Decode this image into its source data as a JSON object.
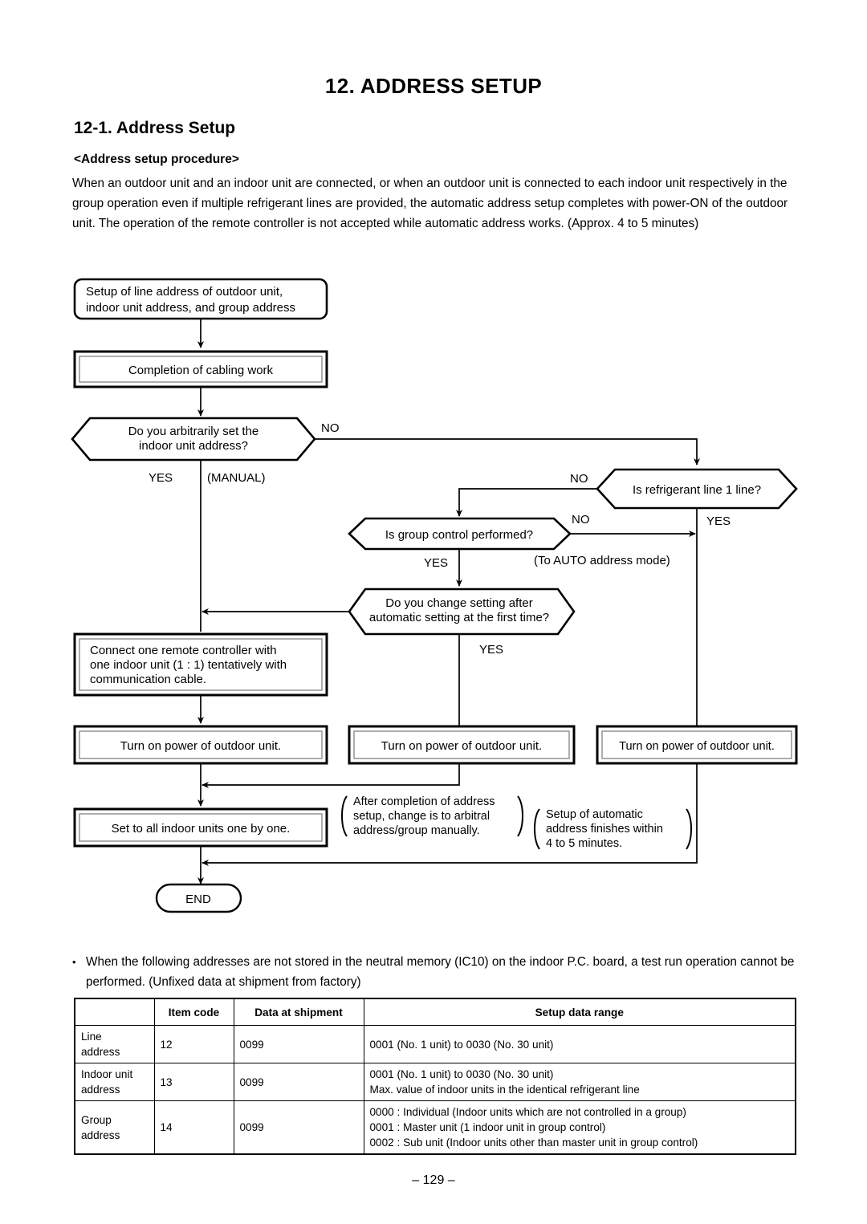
{
  "document": {
    "chapter_title": "12.  ADDRESS SETUP",
    "section_title": "12-1.  Address Setup",
    "sub_title": "<Address setup procedure>",
    "intro_paragraph": "When an outdoor unit and an indoor unit are connected, or when an outdoor unit is connected to each indoor unit respectively in the group operation even if multiple refrigerant lines are provided, the automatic address setup completes with power-ON of the outdoor unit. The operation of the remote controller is not accepted while automatic address works. (Approx. 4 to 5 minutes)",
    "page_number": "–  129  –"
  },
  "flowchart": {
    "start_box": {
      "line1": "Setup of line address of outdoor unit,",
      "line2": "indoor unit address, and group address"
    },
    "cabling_box": "Completion of cabling work",
    "decision_arbitrary": {
      "line1": "Do you arbitrarily set the",
      "line2": "indoor unit address?",
      "yes": "YES",
      "no": "NO",
      "manual": "(MANUAL)"
    },
    "decision_refrigerant": {
      "text": "Is refrigerant line 1 line?",
      "yes": "YES",
      "no": "NO"
    },
    "decision_group": {
      "text": "Is group control performed?",
      "yes": "YES",
      "no": "NO",
      "auto_note": "(To AUTO address mode)"
    },
    "decision_change": {
      "line1": "Do you change setting after",
      "line2": "automatic setting at the first time?",
      "yes": "YES"
    },
    "connect_box": {
      "line1": "Connect one remote controller with",
      "line2": "one indoor unit (1 : 1) tentatively with",
      "line3": "communication cable."
    },
    "power_box_1": "Turn on power of outdoor unit.",
    "power_box_2": "Turn on power of outdoor unit.",
    "power_box_3": "Turn on power of outdoor unit.",
    "set_all_box": "Set to all indoor units one by one.",
    "end_box": "END",
    "note_manual": {
      "line1": "After completion of address",
      "line2": "setup, change is to arbitral",
      "line3": "address/group manually."
    },
    "note_auto": {
      "line1": "Setup of automatic",
      "line2": "address finishes within",
      "line3": "4 to 5 minutes."
    }
  },
  "note": {
    "bullet": "•",
    "text": "When the following addresses are not stored in the neutral memory (IC10) on the indoor P.C. board, a test run operation cannot be performed. (Unfixed data at shipment from factory)"
  },
  "table": {
    "headers": {
      "blank": "",
      "item_code": "Item code",
      "data_at_shipment": "Data at shipment",
      "setup_data_range": "Setup data range"
    },
    "rows": [
      {
        "name_line1": "Line",
        "name_line2": "address",
        "item_code": "12",
        "data_at_shipment": "0099",
        "range": [
          "0001 (No. 1 unit) to 0030 (No. 30 unit)"
        ]
      },
      {
        "name_line1": "Indoor unit",
        "name_line2": "address",
        "item_code": "13",
        "data_at_shipment": "0099",
        "range": [
          "0001 (No. 1 unit) to 0030 (No. 30 unit)",
          "Max. value of indoor units in the identical refrigerant line"
        ]
      },
      {
        "name_line1": "Group",
        "name_line2": "address",
        "item_code": "14",
        "data_at_shipment": "0099",
        "range": [
          "0000 : Individual (Indoor units which are not controlled in a group)",
          "0001 : Master unit (1 indoor unit in group control)",
          "0002 : Sub unit (Indoor units other than master unit in group control)"
        ]
      }
    ]
  }
}
